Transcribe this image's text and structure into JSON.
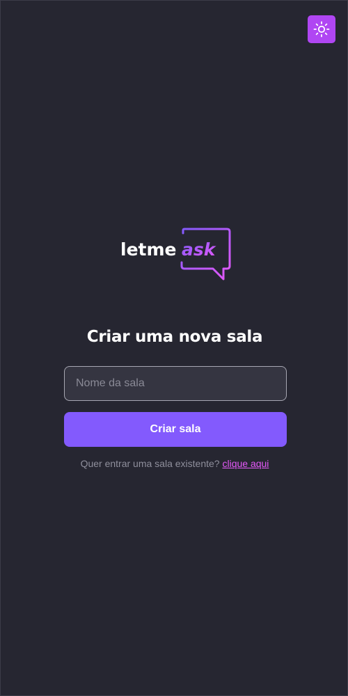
{
  "theme_toggle": {
    "icon": "sun-icon",
    "accent": "#b046f3"
  },
  "logo": {
    "part1": "letme",
    "part2": "ask",
    "gradient": [
      "#835afd",
      "#e559f9"
    ]
  },
  "main": {
    "title": "Criar uma nova sala",
    "room_name_placeholder": "Nome da sala",
    "room_name_value": "",
    "create_button_label": "Criar sala",
    "join_prompt": "Quer entrar uma sala existente? ",
    "join_link_label": "clique aqui"
  },
  "colors": {
    "background": "#262631",
    "button": "#835afd",
    "link": "#e559f9"
  }
}
